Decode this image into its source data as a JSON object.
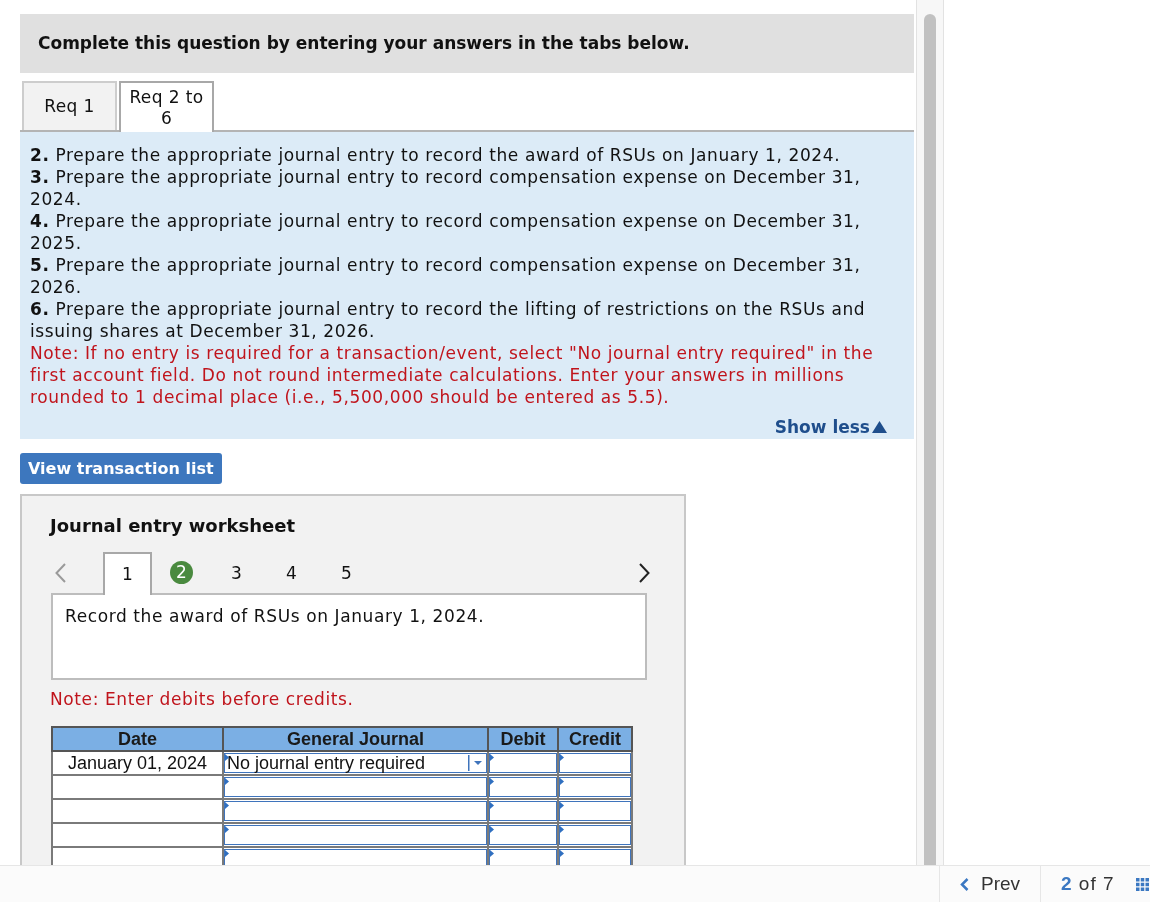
{
  "header": {
    "title": "Complete this question by entering your answers in the tabs below."
  },
  "tabs": [
    {
      "label": "Req 1",
      "selected": false
    },
    {
      "label": "Req 2 to 6",
      "selected": true
    }
  ],
  "instructions": {
    "items": [
      "**2.** Prepare the appropriate journal entry to record the award of RSUs on January 1, 2024.",
      "**3.** Prepare the appropriate journal entry to record compensation expense on December 31, 2024.",
      "**4.** Prepare the appropriate journal entry to record compensation expense on December 31, 2025.",
      "**5.** Prepare the appropriate journal entry to record compensation expense on December 31, 2026.",
      "**6.** Prepare the appropriate journal entry to record the lifting of restrictions on the RSUs and issuing shares at December 31, 2026."
    ],
    "note": "Note: If no entry is required for a transaction/event, select \"No journal entry required\" in the first account field. Do not round intermediate calculations. Enter your answers in millions rounded to 1 decimal place (i.e., 5,500,000 should be entered as 5.5).",
    "toggle": "Show less"
  },
  "view_transactions_button": "View transaction list",
  "worksheet": {
    "title": "Journal entry worksheet",
    "prev_disabled": true,
    "next_disabled": false,
    "pages": [
      {
        "label": "1",
        "selected": true,
        "completed": false
      },
      {
        "label": "2",
        "selected": false,
        "completed": true
      },
      {
        "label": "3",
        "selected": false,
        "completed": false
      },
      {
        "label": "4",
        "selected": false,
        "completed": false
      },
      {
        "label": "5",
        "selected": false,
        "completed": false
      }
    ],
    "prompt": "Record the award of RSUs on January 1, 2024.",
    "note": "Note: Enter debits before credits.",
    "table": {
      "columns": [
        "Date",
        "General Journal",
        "Debit",
        "Credit"
      ],
      "rows": [
        {
          "date": "January 01, 2024",
          "account": "No journal entry required"
        },
        {},
        {},
        {},
        {}
      ]
    }
  },
  "pager": {
    "prev": "Prev",
    "position": "**2** of 7"
  }
}
